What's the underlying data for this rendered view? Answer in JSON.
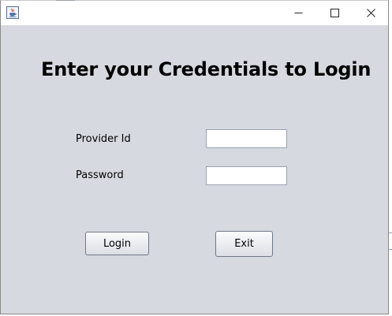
{
  "window": {
    "title": "",
    "controls": {
      "minimize": "minimize",
      "maximize": "maximize",
      "close": "close"
    }
  },
  "form": {
    "heading": "Enter your Credentials to Login",
    "fields": [
      {
        "label": "Provider Id",
        "value": "",
        "placeholder": ""
      },
      {
        "label": "Password",
        "value": "",
        "placeholder": ""
      }
    ],
    "buttons": {
      "login": "Login",
      "exit": "Exit"
    }
  },
  "icons": {
    "app": "java-coffee-cup-icon",
    "minimize": "minimize-icon",
    "maximize": "maximize-icon",
    "close": "close-icon"
  },
  "colors": {
    "client_background": "#d6d9df",
    "titlebar_background": "#ffffff",
    "field_background": "#ffffff"
  }
}
